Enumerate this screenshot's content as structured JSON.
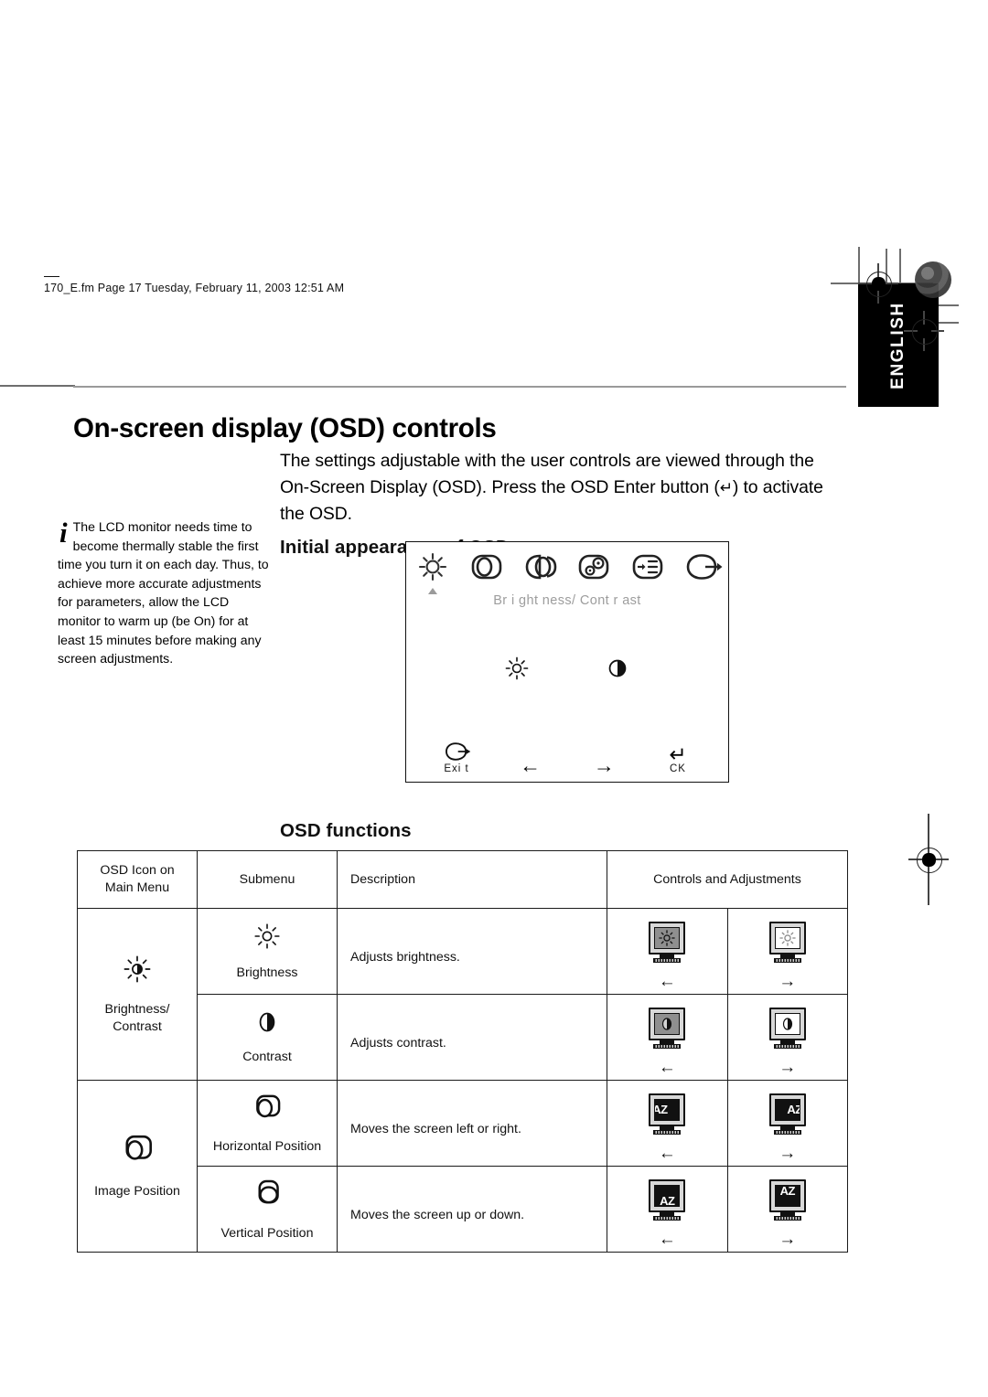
{
  "document": {
    "fm_header": "170_E.fm  Page 17  Tuesday, February 11, 2003  12:51 AM",
    "page_title": "On-screen display (OSD) controls",
    "language_tab": "ENGLISH",
    "intro_before": "The settings adjustable with the user controls are viewed through the On-Screen Display (OSD). Press the OSD Enter button (",
    "intro_enter_glyph": "↵",
    "intro_after": ") to activate the OSD.",
    "note": {
      "icon": "info-italic-i",
      "text": "The LCD monitor needs time to become thermally stable the first time you turn it on each day. Thus, to achieve more accurate adjustments for parameters, allow the LCD monitor to warm up (be On) for at least 15 minutes before making any screen adjustments."
    },
    "sections": {
      "initial_appearance": "Initial appearance of OSD",
      "osd_functions": "OSD functions"
    }
  },
  "osd_mock": {
    "top_icons": [
      {
        "name": "brightness-contrast-icon",
        "selected": true
      },
      {
        "name": "image-position-icon",
        "selected": false
      },
      {
        "name": "image-setup-icon",
        "selected": false
      },
      {
        "name": "color-icon",
        "selected": false
      },
      {
        "name": "options-icon",
        "selected": false
      },
      {
        "name": "exit-icon",
        "selected": false
      }
    ],
    "menu_label": "Br i ght ness/ Cont r ast",
    "mid_icons": [
      "brightness-sun-icon",
      "contrast-half-circle-icon"
    ],
    "bottom_buttons": [
      {
        "name": "exit-button",
        "label": "Exi t"
      },
      {
        "name": "left-arrow-button",
        "label": ""
      },
      {
        "name": "right-arrow-button",
        "label": ""
      },
      {
        "name": "ok-button",
        "label": "CK"
      }
    ]
  },
  "table": {
    "headers": {
      "icon": "OSD Icon on\nMain Menu",
      "icon_line1": "OSD Icon on",
      "icon_line2": "Main Menu",
      "submenu": "Submenu",
      "description": "Description",
      "controls": "Controls and Adjustments"
    },
    "groups": [
      {
        "main_icon": "brightness-contrast-icon",
        "main_label_line1": "Brightness/",
        "main_label_line2": "Contrast",
        "rows": [
          {
            "sub_icon": "brightness-sun-icon",
            "submenu": "Brightness",
            "description": "Adjusts brightness.",
            "controls": [
              {
                "icon": "monitor-brightness-dark-icon",
                "arrow": "←"
              },
              {
                "icon": "monitor-brightness-light-icon",
                "arrow": "→"
              }
            ]
          },
          {
            "sub_icon": "contrast-half-circle-icon",
            "submenu": "Contrast",
            "description": "Adjusts contrast.",
            "controls": [
              {
                "icon": "monitor-contrast-low-icon",
                "arrow": "←"
              },
              {
                "icon": "monitor-contrast-high-icon",
                "arrow": "→"
              }
            ]
          }
        ]
      },
      {
        "main_icon": "image-position-icon",
        "main_label_line1": "Image Position",
        "main_label_line2": "",
        "rows": [
          {
            "sub_icon": "horizontal-position-icon",
            "submenu": "Horizontal Position",
            "description": "Moves the screen left or right.",
            "controls": [
              {
                "icon": "monitor-shift-left-icon",
                "arrow": "←",
                "az": "AZ"
              },
              {
                "icon": "monitor-shift-right-icon",
                "arrow": "→",
                "az": "AZ"
              }
            ]
          },
          {
            "sub_icon": "vertical-position-icon",
            "submenu": "Vertical Position",
            "description": "Moves the screen up or down.",
            "controls": [
              {
                "icon": "monitor-shift-down-icon",
                "arrow": "←",
                "az": "AZ"
              },
              {
                "icon": "monitor-shift-up-icon",
                "arrow": "→",
                "az": "AZ"
              }
            ]
          }
        ]
      }
    ]
  },
  "colors": {
    "rule": "#9a9a9a",
    "osd_label_gray": "#9d9d9d",
    "tab_bg": "#000000",
    "ink": "#111111"
  }
}
